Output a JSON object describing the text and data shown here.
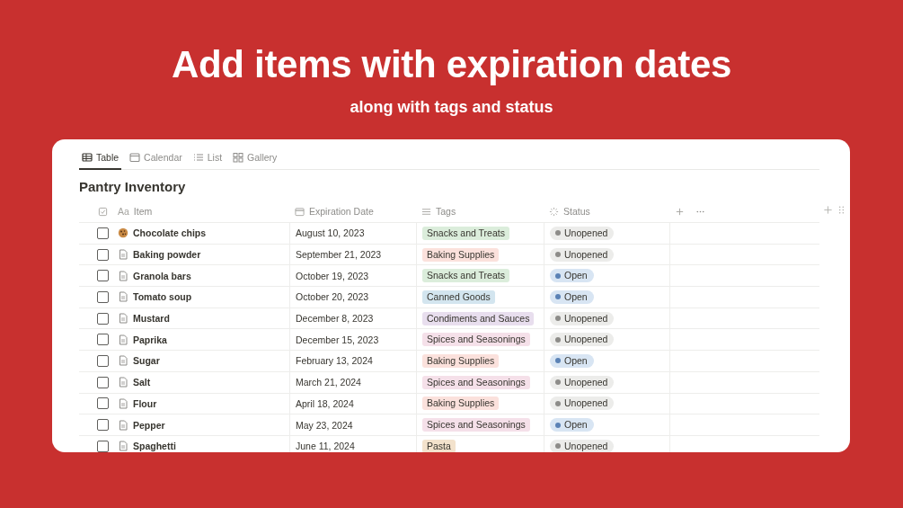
{
  "headline": "Add items with expiration dates",
  "subheadline": "along with tags and status",
  "tabs": [
    {
      "label": "Table",
      "kind": "table",
      "selected": true
    },
    {
      "label": "Calendar",
      "kind": "calendar",
      "selected": false
    },
    {
      "label": "List",
      "kind": "list",
      "selected": false
    },
    {
      "label": "Gallery",
      "kind": "gallery",
      "selected": false
    }
  ],
  "database_title": "Pantry Inventory",
  "columns": [
    {
      "prefix": "Aa",
      "label": "Item",
      "kind": "title"
    },
    {
      "label": "Expiration Date",
      "kind": "date"
    },
    {
      "label": "Tags",
      "kind": "tags"
    },
    {
      "label": "Status",
      "kind": "status"
    }
  ],
  "rows": [
    {
      "checked": false,
      "kind": "emoji",
      "item": "Chocolate chips",
      "date": "August 10, 2023",
      "tag": {
        "label": "Snacks and Treats",
        "color": "#dbeddb"
      },
      "status": {
        "label": "Unopened",
        "kind": "unopened"
      }
    },
    {
      "checked": false,
      "kind": "page",
      "item": "Baking powder",
      "date": "September 21, 2023",
      "tag": {
        "label": "Baking Supplies",
        "color": "#fbe1dc"
      },
      "status": {
        "label": "Unopened",
        "kind": "unopened"
      }
    },
    {
      "checked": false,
      "kind": "page",
      "item": "Granola bars",
      "date": "October 19, 2023",
      "tag": {
        "label": "Snacks and Treats",
        "color": "#dbeddb"
      },
      "status": {
        "label": "Open",
        "kind": "open"
      }
    },
    {
      "checked": false,
      "kind": "page",
      "item": "Tomato soup",
      "date": "October 20, 2023",
      "tag": {
        "label": "Canned Goods",
        "color": "#d3e5ef"
      },
      "status": {
        "label": "Open",
        "kind": "open"
      }
    },
    {
      "checked": false,
      "kind": "page",
      "item": "Mustard",
      "date": "December 8, 2023",
      "tag": {
        "label": "Condiments and Sauces",
        "color": "#e8deee"
      },
      "status": {
        "label": "Unopened",
        "kind": "unopened"
      }
    },
    {
      "checked": false,
      "kind": "page",
      "item": "Paprika",
      "date": "December 15, 2023",
      "tag": {
        "label": "Spices and Seasonings",
        "color": "#f5e0e9"
      },
      "status": {
        "label": "Unopened",
        "kind": "unopened"
      }
    },
    {
      "checked": false,
      "kind": "page",
      "item": "Sugar",
      "date": "February 13, 2024",
      "tag": {
        "label": "Baking Supplies",
        "color": "#fbe1dc"
      },
      "status": {
        "label": "Open",
        "kind": "open"
      }
    },
    {
      "checked": false,
      "kind": "page",
      "item": "Salt",
      "date": "March 21, 2024",
      "tag": {
        "label": "Spices and Seasonings",
        "color": "#f5e0e9"
      },
      "status": {
        "label": "Unopened",
        "kind": "unopened"
      }
    },
    {
      "checked": false,
      "kind": "page",
      "item": "Flour",
      "date": "April 18, 2024",
      "tag": {
        "label": "Baking Supplies",
        "color": "#fbe1dc"
      },
      "status": {
        "label": "Unopened",
        "kind": "unopened"
      }
    },
    {
      "checked": false,
      "kind": "page",
      "item": "Pepper",
      "date": "May 23, 2024",
      "tag": {
        "label": "Spices and Seasonings",
        "color": "#f5e0e9"
      },
      "status": {
        "label": "Open",
        "kind": "open"
      }
    },
    {
      "checked": false,
      "kind": "page",
      "item": "Spaghetti",
      "date": "June 11, 2024",
      "tag": {
        "label": "Pasta",
        "color": "#f3e2cc"
      },
      "status": {
        "label": "Unopened",
        "kind": "unopened"
      }
    }
  ]
}
